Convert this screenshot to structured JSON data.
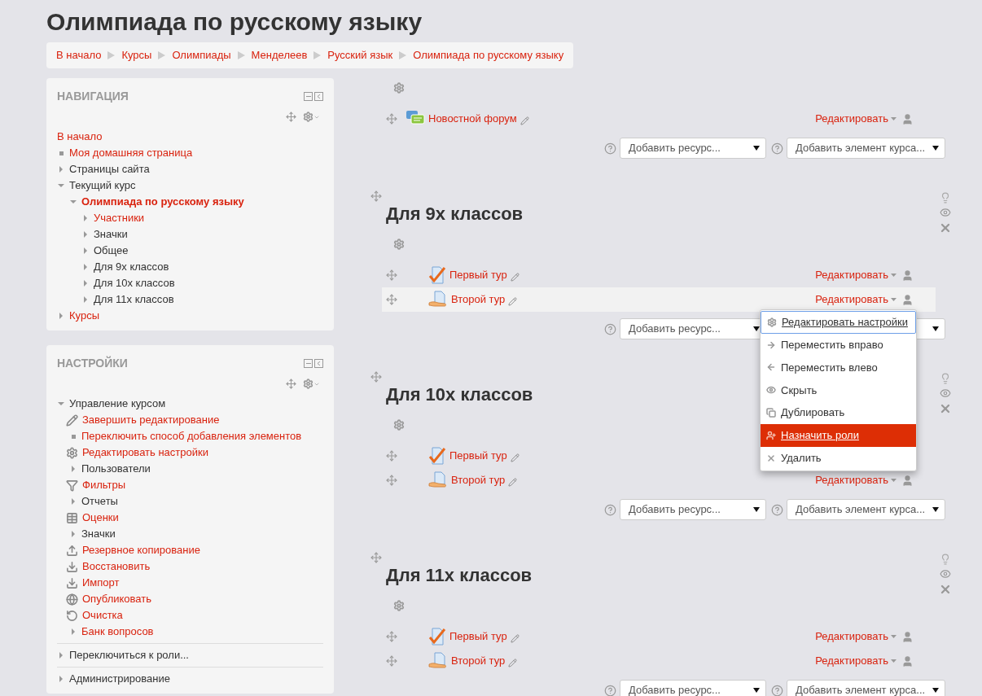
{
  "page_title": "Олимпиада по русскому языку",
  "breadcrumb": [
    "В начало",
    "Курсы",
    "Олимпиады",
    "Менделеев",
    "Русский язык",
    "Олимпиада по русскому языку"
  ],
  "blocks": [
    {
      "title": "НАВИГАЦИЯ",
      "items": [
        {
          "label": "В начало",
          "kind": "plain",
          "link": true
        },
        {
          "label": "Моя домашняя страница",
          "kind": "leaf",
          "link": true
        },
        {
          "label": "Страницы сайта",
          "kind": "branch",
          "link": false,
          "expanded": false
        },
        {
          "label": "Текущий курс",
          "kind": "branch",
          "link": false,
          "expanded": true,
          "children": [
            {
              "label": "Олимпиада по русскому языку",
              "kind": "branch",
              "link": true,
              "current": true,
              "expanded": true,
              "children": [
                {
                  "label": "Участники",
                  "kind": "branch",
                  "link": true,
                  "expanded": false
                },
                {
                  "label": "Значки",
                  "kind": "branch",
                  "link": false,
                  "expanded": false
                },
                {
                  "label": "Общее",
                  "kind": "branch",
                  "link": false,
                  "expanded": false
                },
                {
                  "label": "Для 9х классов",
                  "kind": "branch",
                  "link": false,
                  "expanded": false
                },
                {
                  "label": "Для 10х классов",
                  "kind": "branch",
                  "link": false,
                  "expanded": false
                },
                {
                  "label": "Для 11х классов",
                  "kind": "branch",
                  "link": false,
                  "expanded": false
                }
              ]
            }
          ]
        },
        {
          "label": "Курсы",
          "kind": "branch",
          "link": true,
          "expanded": false
        }
      ]
    },
    {
      "title": "НАСТРОЙКИ",
      "items": [
        {
          "label": "Управление курсом",
          "kind": "branch",
          "link": false,
          "expanded": true,
          "children": [
            {
              "label": "Завершить редактирование",
              "kind": "edit",
              "link": true
            },
            {
              "label": "Переключить способ добавления элементов",
              "kind": "leaf",
              "link": true
            },
            {
              "label": "Редактировать настройки",
              "kind": "gear",
              "link": true
            },
            {
              "label": "Пользователи",
              "kind": "branch",
              "link": false,
              "expanded": false
            },
            {
              "label": "Фильтры",
              "kind": "filter",
              "link": true
            },
            {
              "label": "Отчеты",
              "kind": "branch",
              "link": false,
              "expanded": false
            },
            {
              "label": "Оценки",
              "kind": "grades",
              "link": true
            },
            {
              "label": "Значки",
              "kind": "branch",
              "link": false,
              "expanded": false
            },
            {
              "label": "Резервное копирование",
              "kind": "backup",
              "link": true
            },
            {
              "label": "Восстановить",
              "kind": "restore",
              "link": true
            },
            {
              "label": "Импорт",
              "kind": "restore",
              "link": true
            },
            {
              "label": "Опубликовать",
              "kind": "publish",
              "link": true
            },
            {
              "label": "Очистка",
              "kind": "reset",
              "link": true
            },
            {
              "label": "Банк вопросов",
              "kind": "branch",
              "link": true,
              "expanded": false
            }
          ]
        },
        {
          "label": "Переключиться к роли...",
          "kind": "branch",
          "link": false,
          "expanded": false
        },
        {
          "label": "Администрирование",
          "kind": "branch",
          "link": false,
          "expanded": false
        }
      ]
    }
  ],
  "sections": [
    {
      "items": [
        {
          "name": "Новостной форум",
          "kind": "forum",
          "edit": "Редактировать",
          "highlighted": false
        }
      ],
      "add_resource": "Добавить ресурс...",
      "add_activity": "Добавить элемент курса..."
    },
    {
      "title": "Для 9х классов",
      "items": [
        {
          "name": "Первый тур",
          "kind": "quiz",
          "edit": "Редактировать",
          "highlighted": false
        },
        {
          "name": "Второй тур",
          "kind": "assign",
          "edit": "Редактировать",
          "highlighted": true,
          "menu": [
            {
              "label": "Редактировать настройки",
              "kind": "gear",
              "focused": true,
              "selected": false
            },
            {
              "label": "Переместить вправо",
              "kind": "right",
              "focused": false,
              "selected": false
            },
            {
              "label": "Переместить влево",
              "kind": "left",
              "focused": false,
              "selected": false
            },
            {
              "label": "Скрыть",
              "kind": "hide",
              "focused": false,
              "selected": false
            },
            {
              "label": "Дублировать",
              "kind": "duplicate",
              "focused": false,
              "selected": false
            },
            {
              "label": "Назначить роли",
              "kind": "roles",
              "focused": false,
              "selected": true
            },
            {
              "label": "Удалить",
              "kind": "delete",
              "focused": false,
              "selected": false
            }
          ]
        }
      ],
      "add_resource": "Добавить ресурс..."
    },
    {
      "title": "Для 10х классов",
      "items": [
        {
          "name": "Первый тур",
          "kind": "quiz",
          "highlighted": false
        },
        {
          "name": "Второй тур",
          "kind": "assign",
          "edit": "Редактировать",
          "highlighted": false
        }
      ],
      "add_resource": "Добавить ресурс...",
      "add_activity": "Добавить элемент курса..."
    },
    {
      "title": "Для 11х классов",
      "items": [
        {
          "name": "Первый тур",
          "kind": "quiz",
          "edit": "Редактировать",
          "highlighted": false
        },
        {
          "name": "Второй тур",
          "kind": "assign",
          "edit": "Редактировать",
          "highlighted": false
        }
      ],
      "add_resource": "Добавить ресурс...",
      "add_activity": "Добавить элемент курса..."
    }
  ]
}
